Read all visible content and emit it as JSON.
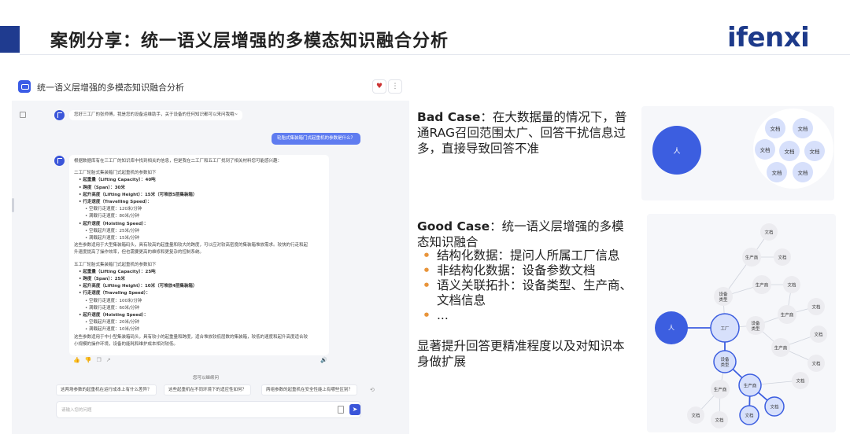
{
  "slide": {
    "title": "案例分享：统一语义层增强的多模态知识融合分析",
    "logo": "ifenxi"
  },
  "app": {
    "title": "统一语义层增强的多模态知识融合分析",
    "greeting": "您好三工厂的张师傅，我是您的设备运维助手，关于设备的任何知识都可以来问我哦~",
    "user_question": "轮胎式集装箱门式起重机的参数是什么？",
    "answer_lines": [
      {
        "t": "根据数据库有在三工厂的知识库中找到相关的信息，但是我在二工厂和五工厂找到了相关材料您可能感兴趣：",
        "c": ""
      },
      {
        "t": "",
        "c": "gap"
      },
      {
        "t": "二工厂轮胎式集装箱门式起重机的参数如下",
        "c": ""
      },
      {
        "t": "• 起重量（Lifting Capacity）：40吨",
        "c": "i1 b"
      },
      {
        "t": "• 跨度（Span）：30米",
        "c": "i1 b"
      },
      {
        "t": "• 起升高度（Lifting Height）：15米（可堆放5层集装箱）",
        "c": "i1 b"
      },
      {
        "t": "• 行走速度（Travelling Speed）：",
        "c": "i1 b"
      },
      {
        "t": "• 空载行走速度：120米/分钟",
        "c": "i2"
      },
      {
        "t": "• 满载行走速度：80米/分钟",
        "c": "i2"
      },
      {
        "t": "• 起升速度（Hoisting Speed）：",
        "c": "i1 b"
      },
      {
        "t": "• 空载起升速度：25米/分钟",
        "c": "i2"
      },
      {
        "t": "• 满载起升速度：15米/分钟",
        "c": "i2"
      },
      {
        "t": "这些参数适用于大型集装箱码头，具有较高的起重量和较大的跨度，可以应对较高密度的集装箱堆放需求。较快的行走和起",
        "c": ""
      },
      {
        "t": "升速度提高了操作效率，但也需要更高的维修和更复杂的控制系统。",
        "c": ""
      },
      {
        "t": "",
        "c": "gap"
      },
      {
        "t": "五工厂轮胎式集装箱门式起重机的参数如下",
        "c": ""
      },
      {
        "t": "• 起重量（Lifting Capacity）：25吨",
        "c": "i1 b"
      },
      {
        "t": "• 跨度（Span）：25米",
        "c": "i1 b"
      },
      {
        "t": "• 起升高度（Lifting Height）：10米（可堆放4层集装箱）",
        "c": "i1 b"
      },
      {
        "t": "• 行走速度（Traveling Speed）：",
        "c": "i1 b"
      },
      {
        "t": "• 空载行走速度：100米/分钟",
        "c": "i2"
      },
      {
        "t": "• 满载行走速度：60米/分钟",
        "c": "i2"
      },
      {
        "t": "• 起升速度（Hoisting Speed）：",
        "c": "i1 b"
      },
      {
        "t": "• 空载起升速度：20米/分钟",
        "c": "i2"
      },
      {
        "t": "• 满载起升速度：10米/分钟",
        "c": "i2"
      },
      {
        "t": "这些参数适用于中小型集装箱码头，具有较小的起重量和跨度，适合堆放较低层数的集装箱，较低的速度和起升高度适合较",
        "c": ""
      },
      {
        "t": "小规模的操作环境，设备的能耗和维护成本相对较低。",
        "c": ""
      }
    ],
    "feedback_icons": [
      "thumb-up-icon",
      "thumb-down-icon",
      "copy-icon",
      "share-icon"
    ],
    "speaker_icon": "speaker-icon",
    "suggest_label": "您可以继续问",
    "suggestions": [
      "这两场参数的起重机在运行成本上有什么差异？",
      "这些起重机在不同环境下的适应性如何？",
      "两组参数的起重机在安全性能上有哪些区别？"
    ],
    "input_placeholder": "请输入您的问题"
  },
  "bad_case": {
    "label": "Bad Case",
    "text": "：在大数据量的情况下，普通RAG召回范围太广、回答干扰信息过多，直接导致回答不准"
  },
  "good_case": {
    "label": "Good Case",
    "text": "：统一语义层增强的多模态知识融合",
    "bullets": [
      "结构化数据：提问人所属工厂信息",
      "非结构化数据：设备参数文档",
      "语义关联拓扑：设备类型、生产商、文档信息",
      "..."
    ]
  },
  "summary": "显著提升回答更精准程度以及对知识本身做扩展",
  "diagram_top": {
    "person": "人",
    "docs": [
      "文档",
      "文档",
      "文档",
      "文档",
      "文档",
      "文档",
      "文档",
      "文档"
    ]
  },
  "diagram_bottom": {
    "person": "人",
    "factory": "工厂",
    "equipment_type": "设备类型",
    "manufacturer": "生产商",
    "document": "文档"
  },
  "colors": {
    "accent": "#1f3b8f",
    "node_blue": "#3c5ee0",
    "node_light": "#d7e0fb",
    "bullet": "#e8943a"
  }
}
